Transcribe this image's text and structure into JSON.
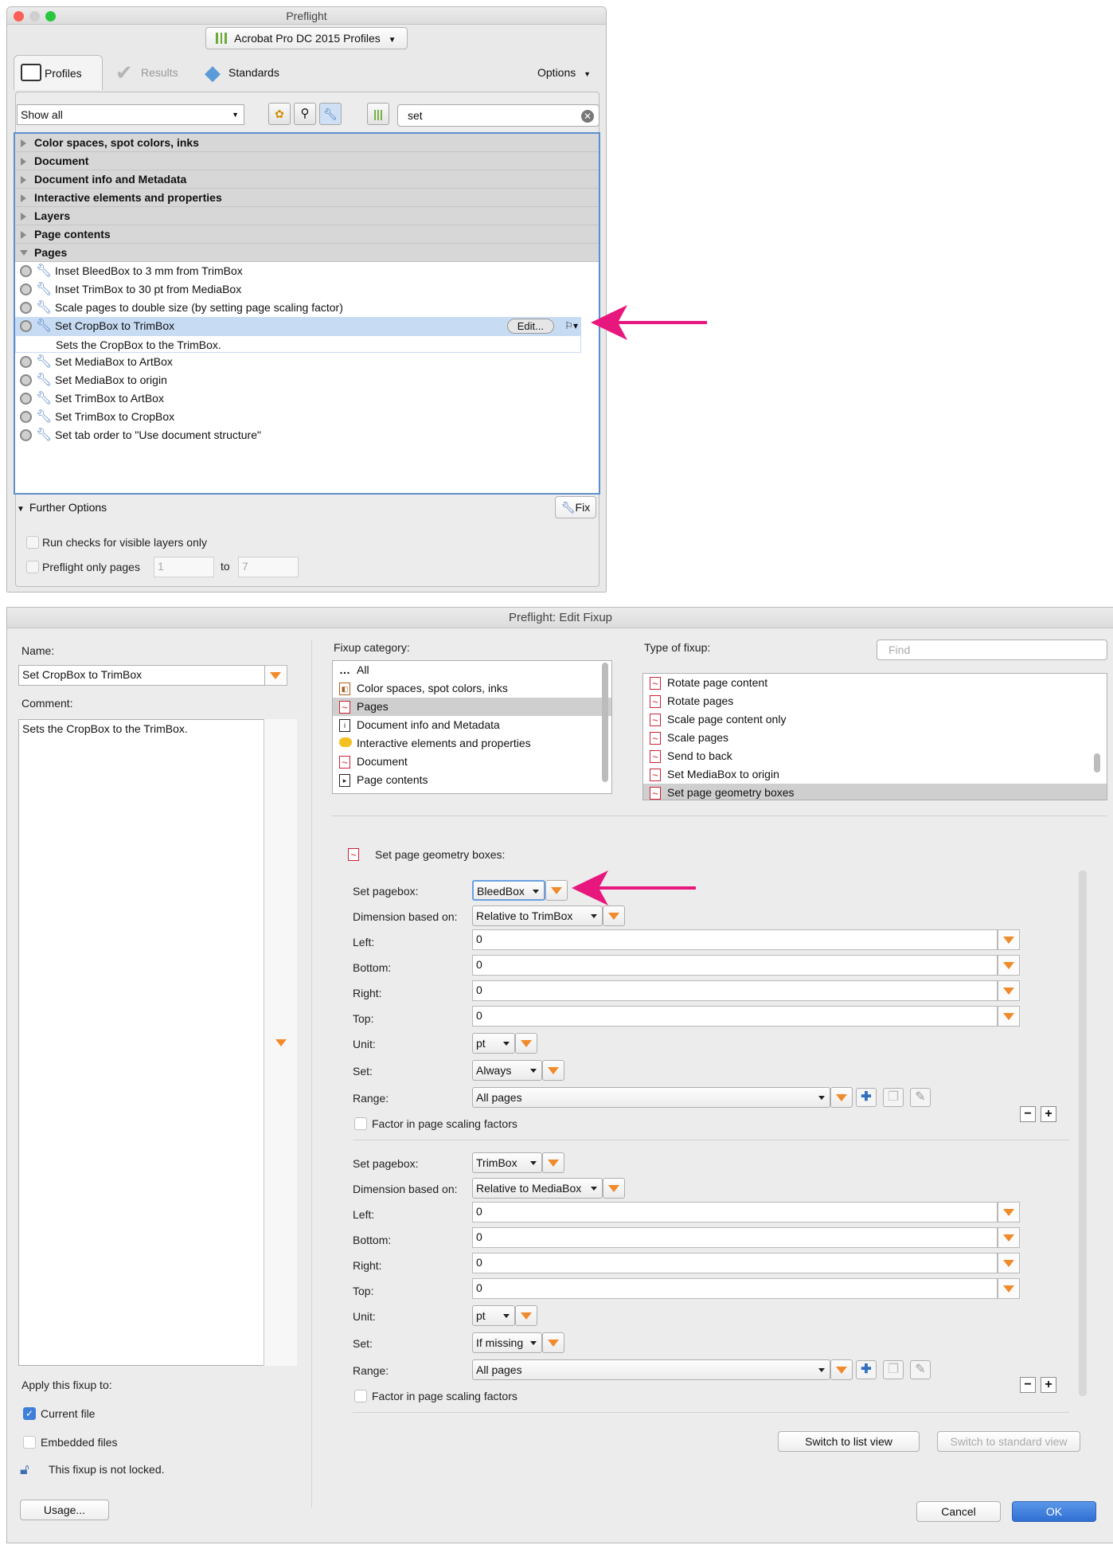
{
  "preflight": {
    "title": "Preflight",
    "profile_button": "Acrobat Pro DC 2015 Profiles",
    "tabs": [
      "Profiles",
      "Results",
      "Standards"
    ],
    "options_label": "Options",
    "show_filter": "Show all",
    "search_value": "set",
    "categories_top": [
      "Color spaces, spot colors, inks",
      "Document",
      "Document info and Metadata",
      "Interactive elements and properties",
      "Layers",
      "Page contents",
      "Pages"
    ],
    "items": [
      "Inset BleedBox to 3 mm from TrimBox",
      "Inset TrimBox to 30 pt from MediaBox",
      "Scale pages to double size (by setting page scaling factor)",
      "Set CropBox to TrimBox",
      "Set MediaBox to ArtBox",
      "Set MediaBox to origin",
      "Set TrimBox to ArtBox",
      "Set TrimBox to CropBox",
      "Set tab order to \"Use document structure\""
    ],
    "selected_description": "Sets the CropBox to the TrimBox.",
    "edit_button": "Edit...",
    "further_options": "Further Options",
    "fix_button": "Fix",
    "run_checks_label": "Run checks for visible layers only",
    "preflight_pages_label": "Preflight only pages",
    "page_from": "1",
    "page_to_label": "to",
    "page_to": "7"
  },
  "edit": {
    "title": "Preflight: Edit Fixup",
    "name_label": "Name:",
    "name_value": "Set CropBox to TrimBox",
    "comment_label": "Comment:",
    "comment_value": "Sets the CropBox to the TrimBox.",
    "fixup_category_label": "Fixup category:",
    "categories": [
      "All",
      "Color spaces, spot colors, inks",
      "Pages",
      "Document info and Metadata",
      "Interactive elements and properties",
      "Document",
      "Page contents"
    ],
    "type_label": "Type of fixup:",
    "find_placeholder": "Find",
    "types": [
      "Rotate page content",
      "Rotate pages",
      "Scale page content only",
      "Scale pages",
      "Send to back",
      "Set MediaBox to origin",
      "Set page geometry boxes"
    ],
    "section_title": "Set page geometry boxes:",
    "labels": {
      "set_pagebox": "Set pagebox:",
      "dimension": "Dimension based on:",
      "left": "Left:",
      "bottom": "Bottom:",
      "right": "Right:",
      "top": "Top:",
      "unit": "Unit:",
      "set": "Set:",
      "range": "Range:",
      "factor": "Factor in page scaling factors"
    },
    "block1": {
      "pagebox": "BleedBox",
      "dimension": "Relative to TrimBox",
      "left": "0",
      "bottom": "0",
      "right": "0",
      "top": "0",
      "unit": "pt",
      "set": "Always",
      "range": "All pages"
    },
    "block2": {
      "pagebox": "TrimBox",
      "dimension": "Relative to MediaBox",
      "left": "0",
      "bottom": "0",
      "right": "0",
      "top": "0",
      "unit": "pt",
      "set": "If missing",
      "range": "All pages"
    },
    "switch_list": "Switch to list view",
    "switch_standard": "Switch to standard view",
    "apply_label": "Apply this fixup to:",
    "current_file": "Current file",
    "embedded_files": "Embedded files",
    "lock_text": "This fixup is not locked.",
    "usage_button": "Usage...",
    "cancel_button": "Cancel",
    "ok_button": "OK"
  },
  "colors": {
    "accent_arrow": "#e8177e",
    "ok_blue": "#3f7fd8",
    "orange": "#f08a2a"
  }
}
